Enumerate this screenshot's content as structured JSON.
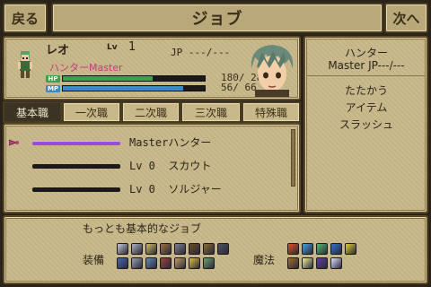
{
  "header": {
    "back_label": "戻る",
    "title": "ジョブ",
    "next_label": "次へ"
  },
  "character": {
    "name": "レオ",
    "lv_label": "Lv",
    "lv": "1",
    "jp": "JP  ---/---",
    "current_job": "ハンターMaster",
    "hp_tag": "HP",
    "mp_tag": "MP",
    "hp_text": "180/ 284",
    "mp_text": " 56/  66",
    "hp_fraction": 0.634,
    "mp_fraction": 0.848
  },
  "selected_job_panel": {
    "job_name": "ハンター",
    "master_line": "Master JP---/---",
    "skills": [
      "たたかう",
      "アイテム",
      "スラッシュ"
    ]
  },
  "tabs": [
    {
      "label": "基本職",
      "active": true
    },
    {
      "label": "一次職",
      "active": false
    },
    {
      "label": "二次職",
      "active": false
    },
    {
      "label": "三次職",
      "active": false
    },
    {
      "label": "特殊職",
      "active": false
    }
  ],
  "job_list": [
    {
      "level": "Master",
      "name": "ハンター",
      "selected": true,
      "progress": 1.0
    },
    {
      "level": "Lv 0  ",
      "name": "スカウト",
      "selected": false,
      "progress": 0
    },
    {
      "level": "Lv 0  ",
      "name": "ソルジャー",
      "selected": false,
      "progress": 0
    }
  ],
  "description": "もっとも基本的なジョブ",
  "equipment": {
    "label": "装備",
    "icons": [
      "sword-icon",
      "dagger-icon",
      "spear-icon",
      "axe-icon",
      "hammer-icon",
      "staff-icon",
      "bow-icon",
      "gun-icon",
      "shield-icon",
      "helmet-icon",
      "armor-icon",
      "robe-icon",
      "gloves-icon",
      "ring-icon",
      "accessory-icon"
    ]
  },
  "magic": {
    "label": "魔法",
    "icons": [
      "fire-icon",
      "ice-icon",
      "wind-icon",
      "water-icon",
      "thunder-icon",
      "earth-icon",
      "light-icon",
      "dark-icon",
      "holy-icon"
    ]
  },
  "colors": {
    "hp_bar": "#3ea04a",
    "mp_bar": "#3a8ac8",
    "job_selected_bar": "#9a4ad8",
    "accent_pink": "#c23c7a"
  }
}
